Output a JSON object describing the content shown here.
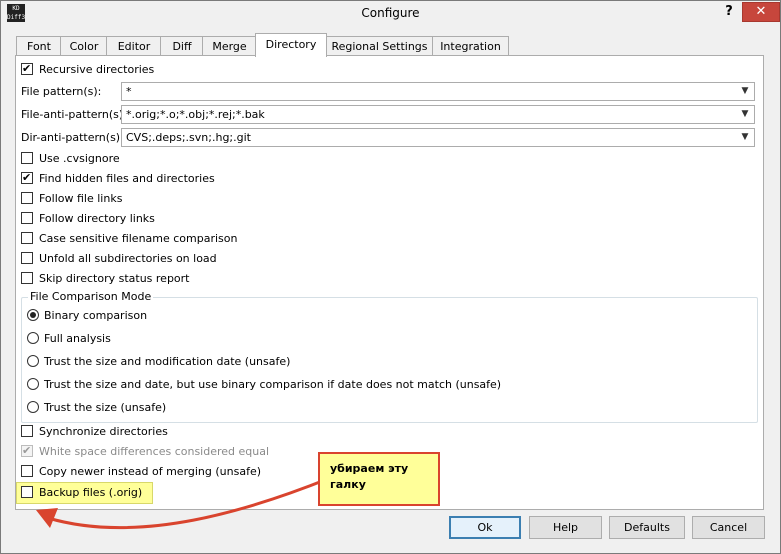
{
  "window": {
    "title": "Configure",
    "app_icon_text": "KD\nDiff3",
    "help_label": "?",
    "close_label": "✕"
  },
  "tabs": [
    {
      "label": "Font"
    },
    {
      "label": "Color"
    },
    {
      "label": "Editor"
    },
    {
      "label": "Diff"
    },
    {
      "label": "Merge"
    },
    {
      "label": "Directory",
      "active": true
    },
    {
      "label": "Regional Settings"
    },
    {
      "label": "Integration"
    }
  ],
  "directory": {
    "recursive": {
      "label": "Recursive directories",
      "checked": true
    },
    "file_pattern": {
      "label": "File pattern(s):",
      "value": "*"
    },
    "file_anti_pattern": {
      "label": "File-anti-pattern(s):",
      "value": "*.orig;*.o;*.obj;*.rej;*.bak"
    },
    "dir_anti_pattern": {
      "label": "Dir-anti-pattern(s):",
      "value": "CVS;.deps;.svn;.hg;.git"
    },
    "options": [
      {
        "label": "Use .cvsignore",
        "checked": false
      },
      {
        "label": "Find hidden files and directories",
        "checked": true
      },
      {
        "label": "Follow file links",
        "checked": false
      },
      {
        "label": "Follow directory links",
        "checked": false
      },
      {
        "label": "Case sensitive filename comparison",
        "checked": false
      },
      {
        "label": "Unfold all subdirectories on load",
        "checked": false
      },
      {
        "label": "Skip directory status report",
        "checked": false
      }
    ],
    "comparison_mode": {
      "title": "File Comparison Mode",
      "options": [
        {
          "label": "Binary comparison",
          "selected": true
        },
        {
          "label": "Full analysis",
          "selected": false
        },
        {
          "label": "Trust the size and modification date (unsafe)",
          "selected": false
        },
        {
          "label": "Trust the size and date, but use binary comparison if date does not match (unsafe)",
          "selected": false
        },
        {
          "label": "Trust the size (unsafe)",
          "selected": false
        }
      ]
    },
    "bottom_options": [
      {
        "label": "Synchronize directories",
        "checked": false,
        "disabled": false
      },
      {
        "label": "White space differences considered equal",
        "checked": true,
        "disabled": true
      },
      {
        "label": "Copy newer instead of merging (unsafe)",
        "checked": false,
        "disabled": false
      },
      {
        "label": "Backup files (.orig)",
        "checked": false,
        "disabled": false
      }
    ]
  },
  "buttons": {
    "ok": "Ok",
    "help": "Help",
    "defaults": "Defaults",
    "cancel": "Cancel"
  },
  "annotation": {
    "text": "убираем эту галку",
    "color": "#d9442e",
    "background": "#ffff99"
  }
}
